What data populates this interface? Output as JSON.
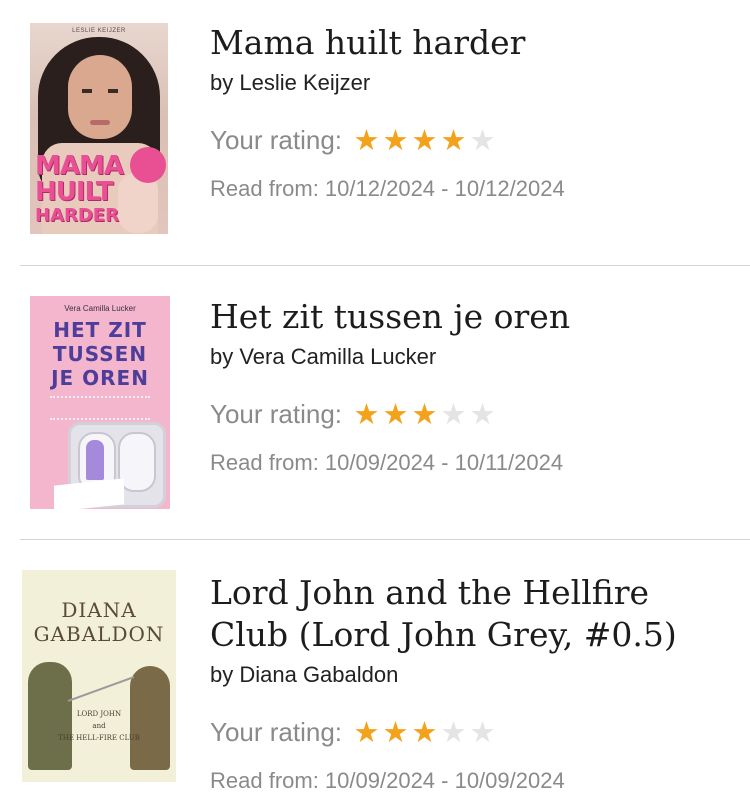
{
  "books": [
    {
      "title": "Mama huilt harder",
      "author": "by Leslie Keijzer",
      "rating_label": "Your rating:",
      "rating": 4,
      "rating_max": 5,
      "read": "Read from: 10/12/2024 - 10/12/2024",
      "cover": {
        "author_line": "LESLIE KEIJZER",
        "words": [
          "MAMA",
          "HUILT",
          "HARDER"
        ]
      }
    },
    {
      "title": "Het zit tussen je oren",
      "author": "by Vera Camilla Lucker",
      "rating_label": "Your rating:",
      "rating": 3,
      "rating_max": 5,
      "read": "Read from: 10/09/2024 - 10/11/2024",
      "cover": {
        "author_line": "Vera Camilla Lucker",
        "words": [
          "HET ZIT",
          "TUSSEN",
          "JE OREN"
        ]
      }
    },
    {
      "title": "Lord John and the Hellfire Club (Lord John Grey, #0.5)",
      "author": "by Diana Gabaldon",
      "rating_label": "Your rating:",
      "rating": 3,
      "rating_max": 5,
      "read": "Read from: 10/09/2024 - 10/09/2024",
      "cover": {
        "author_line": [
          "DIANA",
          "GABALDON"
        ],
        "words": [
          "LORD JOHN",
          "and",
          "THE HELL-FIRE CLUB"
        ]
      }
    }
  ],
  "colors": {
    "star_on": "#f2a31b",
    "star_off": "#e4e4e4",
    "muted_text": "#8a8a8a",
    "divider": "#d4d4d4"
  }
}
